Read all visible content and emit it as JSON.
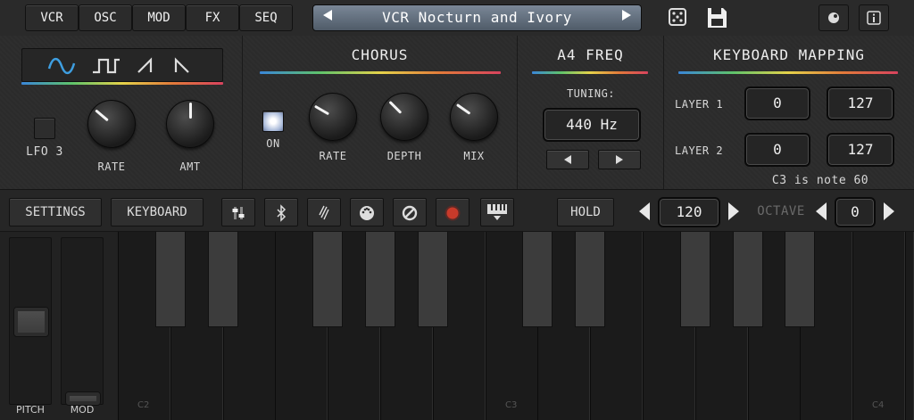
{
  "nav": {
    "tabs": [
      "VCR",
      "OSC",
      "MOD",
      "FX",
      "SEQ"
    ]
  },
  "preset": {
    "prev_icon": "triangle-left-icon",
    "name": "VCR Nocturn and Ivory",
    "next_icon": "triangle-right-icon"
  },
  "top_icons": [
    "dice-icon",
    "floppy-save-icon",
    "record-dot-icon",
    "info-icon"
  ],
  "lfo": {
    "waveforms": [
      "sine-wave-icon",
      "square-wave-icon",
      "saw-up-icon",
      "saw-down-icon"
    ],
    "toggle_label": "LFO 3",
    "rate_label": "RATE",
    "amt_label": "AMT",
    "rate_value": 0.35,
    "amt_value": 0.5
  },
  "chorus": {
    "title": "CHORUS",
    "on_label": "ON",
    "rate_label": "RATE",
    "depth_label": "DEPTH",
    "mix_label": "MIX",
    "rate_value": 0.3,
    "depth_value": 0.38,
    "mix_value": 0.32
  },
  "freq": {
    "title": "A4 FREQ",
    "tuning_label": "TUNING:",
    "value": "440 Hz"
  },
  "mapping": {
    "title": "KEYBOARD MAPPING",
    "layer1_label": "LAYER 1",
    "layer2_label": "LAYER 2",
    "layer1_low": "0",
    "layer1_high": "127",
    "layer2_low": "0",
    "layer2_high": "127",
    "note_text": "C3 is note 60"
  },
  "toolbar": {
    "settings_label": "SETTINGS",
    "keyboard_label": "KEYBOARD",
    "tools": [
      "sliders-icon",
      "bluetooth-icon",
      "link-icon",
      "midi-icon",
      "ban-icon",
      "record-icon",
      "keyboard-down-icon"
    ],
    "hold_label": "HOLD",
    "tempo_value": "120",
    "octave_label": "OCTAVE",
    "octave_value": "0"
  },
  "keyboard": {
    "pitch_label": "PITCH",
    "mod_label": "MOD",
    "note_labels": [
      "C2",
      "C3",
      "C4"
    ]
  },
  "colors": {
    "accent_rainbow": [
      "#3a86d8",
      "#5fc36b",
      "#e5d24a",
      "#e27a3a",
      "#d8435e"
    ],
    "record_red": "#c83a2a",
    "wave_blue": "#3e9ee0"
  }
}
